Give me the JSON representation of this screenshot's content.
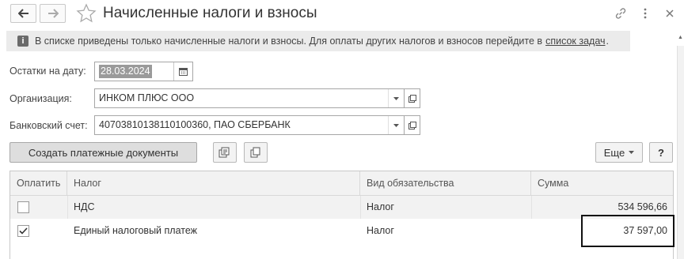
{
  "window": {
    "title": "Начисленные налоги и взносы"
  },
  "info": {
    "text": "В списке приведены только начисленные налоги и взносы. Для оплаты других налогов и взносов перейдите в",
    "link": "список задач",
    "dot": "."
  },
  "form": {
    "date_label": "Остатки на дату:",
    "date_value": "28.03.2024",
    "org_label": "Организация:",
    "org_value": "ИНКОМ ПЛЮС ООО",
    "bank_label": "Банковский счет:",
    "bank_value": "40703810138110100360, ПАО СБЕРБАНК"
  },
  "toolbar": {
    "create_label": "Создать платежные документы",
    "more_label": "Еще",
    "help_label": "?"
  },
  "table": {
    "headers": [
      "Оплатить",
      "Налог",
      "Вид обязательства",
      "Сумма"
    ],
    "rows": [
      {
        "pay": false,
        "tax": "НДС",
        "kind": "Налог",
        "amount": "534 596,66"
      },
      {
        "pay": true,
        "tax": "Единый налоговый платеж",
        "kind": "Налог",
        "amount": "37 597,00"
      }
    ]
  },
  "icons": {
    "back": "arrow-left-icon",
    "forward": "arrow-right-icon",
    "star": "star-icon",
    "link": "link-icon",
    "menu": "more-vertical-icon",
    "close": "close-icon",
    "info": "info-icon",
    "calendar": "calendar-icon"
  }
}
